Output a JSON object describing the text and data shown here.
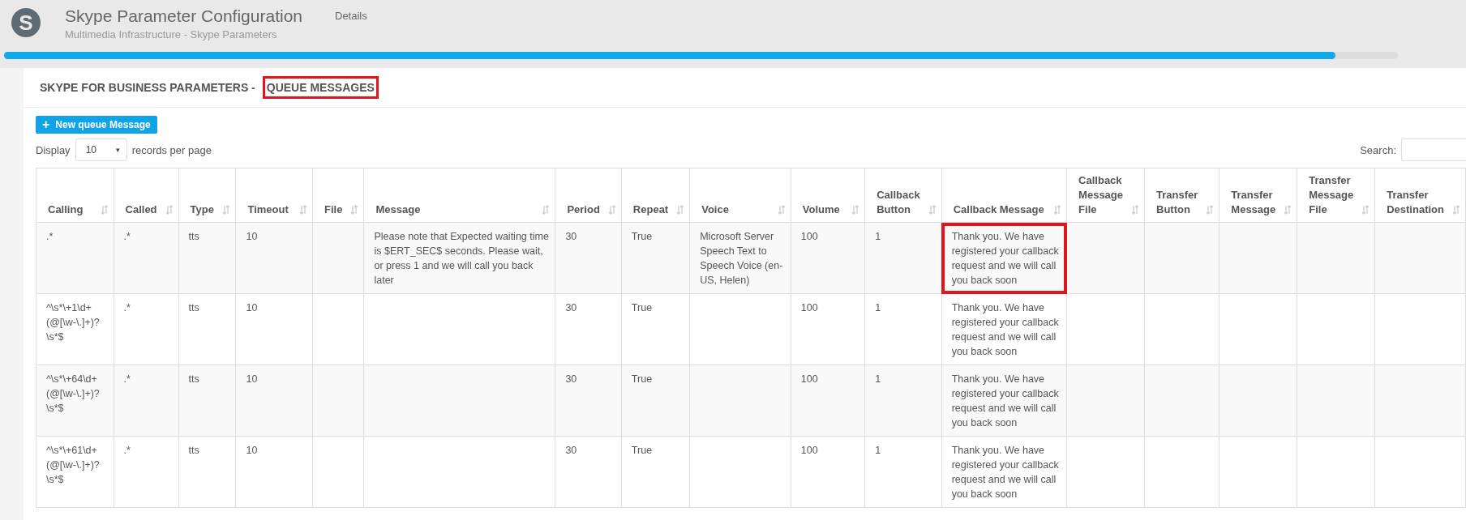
{
  "header": {
    "logo_letter": "S",
    "title": "Skype Parameter Configuration",
    "subtitle": "Multimedia Infrastructure - Skype Parameters",
    "nav": [
      {
        "label": "Details"
      }
    ],
    "progress": {
      "level": 0.955
    }
  },
  "panel": {
    "title_parts": [
      {
        "text": "SKYPE FOR BUSINESS PARAMETERS -",
        "highlighted": false
      },
      {
        "text": "QUEUE MESSAGES",
        "highlighted": true
      }
    ],
    "new_button": {
      "icon": "+",
      "label": "New queue Message"
    },
    "display": {
      "before": "Display",
      "value": "10",
      "caret": "▾",
      "after": "records per page"
    },
    "search": {
      "label": "Search:"
    }
  },
  "table": {
    "columns": [
      "Calling",
      "Called",
      "Type",
      "Timeout",
      "File",
      "Message",
      "Period",
      "Repeat",
      "Voice",
      "Volume",
      "Callback Button",
      "Callback Message",
      "Callback Message File",
      "Transfer Button",
      "Transfer Message",
      "Transfer Message File",
      "Transfer Destination"
    ],
    "rows": [
      {
        "cells": [
          ".*",
          ".*",
          "tts",
          "10",
          null,
          "Please note that Expected waiting time is $ERT_SEC$ seconds. Please wait, or press 1 and we will call you back later",
          "30",
          "True",
          "Microsoft Server Speech Text to Speech Voice (en-US, Helen)",
          "100",
          "1",
          "Thank you. We have registered your callback request and we will call you back soon",
          null,
          null,
          null,
          null,
          null
        ],
        "highlighted": true
      },
      {
        "cells": [
          "^\\s*\\+1\\d+(@[\\w-\\.]+)?\\s*$",
          ".*",
          "tts",
          "10",
          null,
          null,
          "30",
          "True",
          null,
          "100",
          "1",
          "Thank you. We have registered your callback request and we will call you back soon",
          null,
          null,
          null,
          null,
          null
        ],
        "highlighted": false
      },
      {
        "cells": [
          "^\\s*\\+64\\d+(@[\\w-\\.]+)?\\s*$",
          ".*",
          "tts",
          "10",
          null,
          null,
          "30",
          "True",
          null,
          "100",
          "1",
          "Thank you. We have registered your callback request and we will call you back soon",
          null,
          null,
          null,
          null,
          null
        ],
        "highlighted": false
      },
      {
        "cells": [
          "^\\s*\\+61\\d+(@[\\w-\\.]+)?\\s*$",
          ".*",
          "tts",
          "10",
          null,
          null,
          "30",
          "True",
          null,
          "100",
          "1",
          "Thank you. We have registered your callback request and we will call you back soon",
          null,
          null,
          null,
          null,
          null
        ],
        "highlighted": false
      }
    ]
  }
}
